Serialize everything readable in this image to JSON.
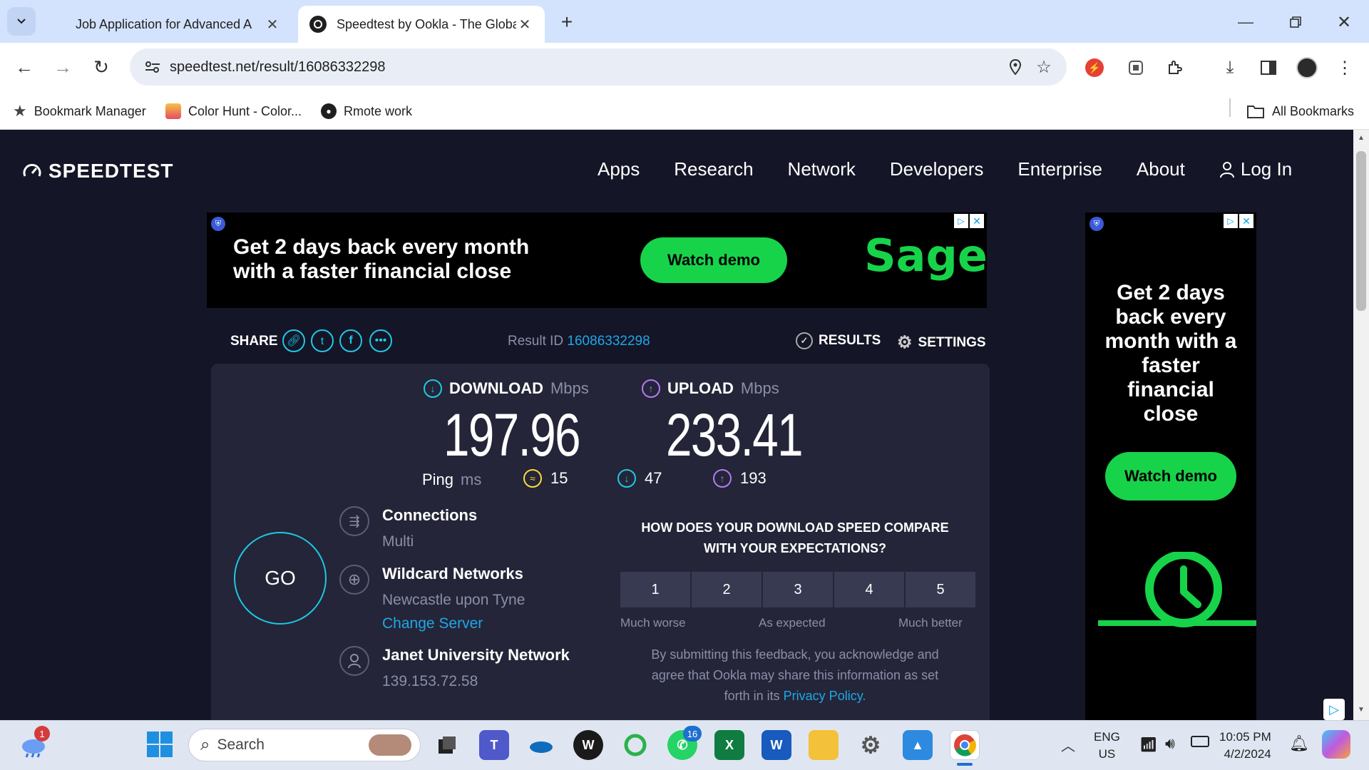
{
  "browser": {
    "tabs": [
      {
        "title": "Job Application for Advanced A",
        "active": false
      },
      {
        "title": "Speedtest by Ookla - The Globa",
        "active": true
      }
    ],
    "url": "speedtest.net/result/16086332298",
    "bookmarks": [
      {
        "label": "Bookmark Manager",
        "icon": "star-icon"
      },
      {
        "label": "Color Hunt - Color...",
        "icon": "color-hunt-icon"
      },
      {
        "label": "Rmote work",
        "icon": "github-icon"
      }
    ],
    "all_bookmarks": "All Bookmarks"
  },
  "site": {
    "logo": "SPEEDTEST",
    "nav": [
      "Apps",
      "Research",
      "Network",
      "Developers",
      "Enterprise",
      "About"
    ],
    "login": "Log In"
  },
  "ad_banner": {
    "line1": "Get 2 days back every month",
    "line2": "with a faster financial close",
    "button": "Watch demo",
    "brand": "Sage"
  },
  "ad_side": {
    "text": "Get 2 days back every month with a faster financial close",
    "button": "Watch demo"
  },
  "result": {
    "share_label": "SHARE",
    "result_id_label": "Result ID",
    "result_id": "16086332298",
    "results_label": "RESULTS",
    "settings_label": "SETTINGS",
    "download_label": "DOWNLOAD",
    "upload_label": "UPLOAD",
    "unit": "Mbps",
    "download": "197.96",
    "upload": "233.41",
    "ping_label": "Ping",
    "ping_unit": "ms",
    "ping_idle": "15",
    "ping_down": "47",
    "ping_up": "193",
    "go": "GO",
    "connections_label": "Connections",
    "connections_value": "Multi",
    "server_name": "Wildcard Networks",
    "server_location": "Newcastle upon Tyne",
    "change_server": "Change Server",
    "isp_name": "Janet University Network",
    "isp_ip": "139.153.72.58"
  },
  "feedback": {
    "question_line1": "HOW DOES YOUR DOWNLOAD SPEED COMPARE",
    "question_line2": "WITH YOUR EXPECTATIONS?",
    "ratings": [
      "1",
      "2",
      "3",
      "4",
      "5"
    ],
    "label_low": "Much worse",
    "label_mid": "As expected",
    "label_high": "Much better",
    "disclaimer_line1": "By submitting this feedback, you acknowledge and",
    "disclaimer_line2": "agree that Ookla may share this information as set",
    "disclaimer_line3_prefix": "forth in its",
    "privacy_link": "Privacy Policy."
  },
  "taskbar": {
    "search_placeholder": "Search",
    "weather_badge": "1",
    "whatsapp_badge": "16",
    "lang_line1": "ENG",
    "lang_line2": "US",
    "time": "10:05 PM",
    "date": "4/2/2024"
  },
  "colors": {
    "accent_cyan": "#1ec8e6",
    "link_blue": "#1fa7e8",
    "ad_green": "#17d34a",
    "upload_purple": "#b27bf4",
    "ping_yellow": "#ffd93b"
  }
}
